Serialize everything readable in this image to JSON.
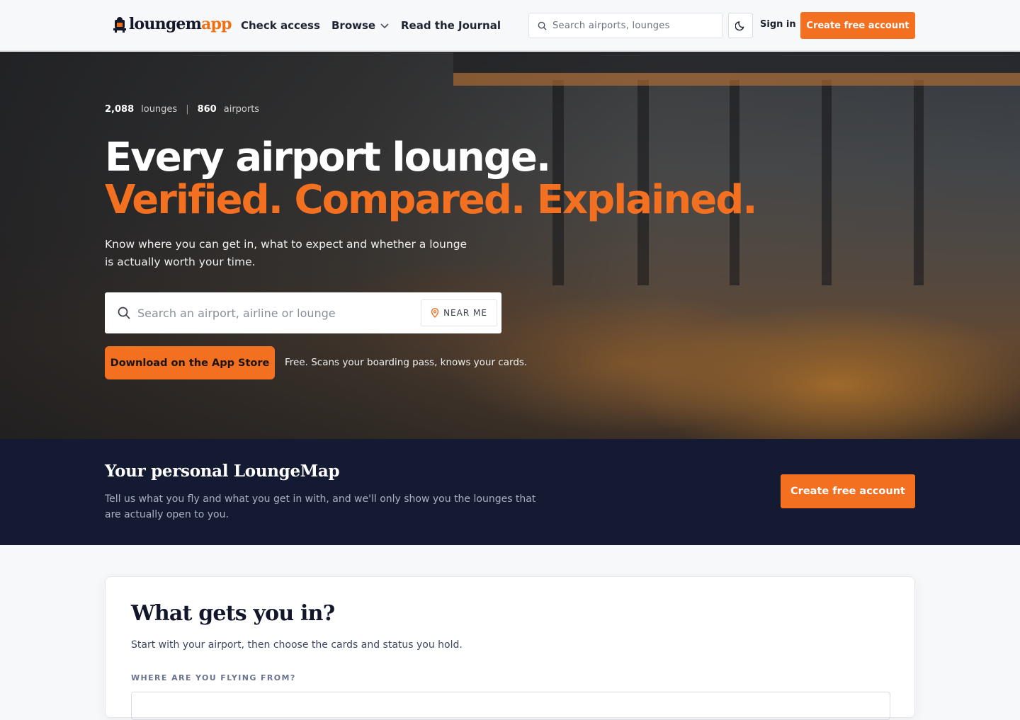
{
  "brand": {
    "logo_part1": "loungem",
    "logo_part2": "app"
  },
  "nav": {
    "check_access": "Check access",
    "browse": "Browse",
    "journal": "Read the Journal"
  },
  "header": {
    "search_placeholder": "Search airports, lounges",
    "sign_in": "Sign in",
    "cta": "Create free account"
  },
  "hero": {
    "stats": {
      "lounges_count": "2,088",
      "lounges_label": "lounges",
      "airports_count": "860",
      "airports_label": "airports"
    },
    "headline_line1": "Every airport lounge.",
    "headline_line2": "Verified. Compared. Explained.",
    "subtitle": "Know where you can get in, what to expect and whether a lounge is actually worth your time.",
    "search_placeholder": "Search an airport, airline or lounge",
    "near_me": "NEAR ME",
    "app_store_button": "Download on the App Store",
    "app_note": "Free. Scans your boarding pass, knows your cards."
  },
  "band": {
    "title": "Your personal LoungeMap",
    "text": "Tell us what you fly and what you get in with, and we'll only show you the lounges that are actually open to you.",
    "cta": "Create free account"
  },
  "card": {
    "title": "What gets you in?",
    "subtitle": "Start with your airport, then choose the cards and status you hold.",
    "field_label": "WHERE ARE YOU FLYING FROM?"
  },
  "colors": {
    "accent": "#f37021",
    "dark_band": "#141a32",
    "header_bg": "#f7f8fa"
  },
  "icons": [
    "logo-icon",
    "chevron-down-icon",
    "search-icon",
    "moon-icon",
    "location-pin-icon"
  ]
}
